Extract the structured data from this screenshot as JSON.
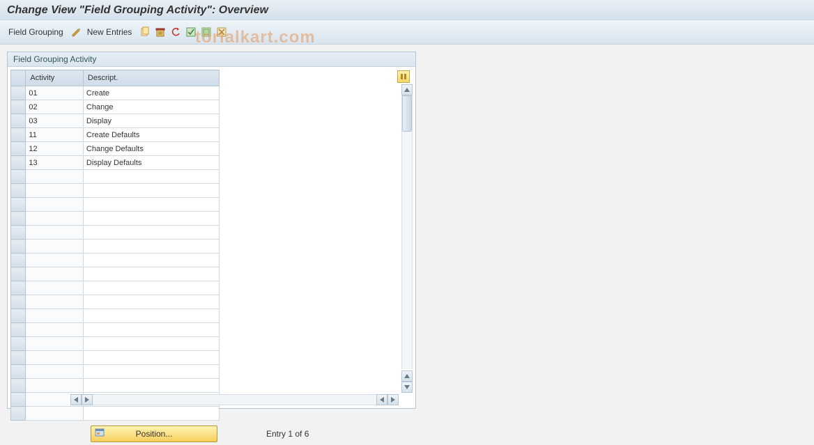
{
  "title": "Change View \"Field Grouping Activity\": Overview",
  "toolbar": {
    "field_grouping": "Field Grouping",
    "new_entries": "New Entries"
  },
  "panel": {
    "header": "Field Grouping Activity",
    "columns": {
      "activity": "Activity",
      "descript": "Descript."
    }
  },
  "rows": [
    {
      "activity": "01",
      "descript": "Create"
    },
    {
      "activity": "02",
      "descript": "Change"
    },
    {
      "activity": "03",
      "descript": "Display"
    },
    {
      "activity": "11",
      "descript": "Create Defaults"
    },
    {
      "activity": "12",
      "descript": "Change Defaults"
    },
    {
      "activity": "13",
      "descript": "Display Defaults"
    }
  ],
  "empty_row_count": 18,
  "footer": {
    "position_btn": "Position...",
    "entry_status": "Entry 1 of 6"
  },
  "watermark": "torialkart.com"
}
